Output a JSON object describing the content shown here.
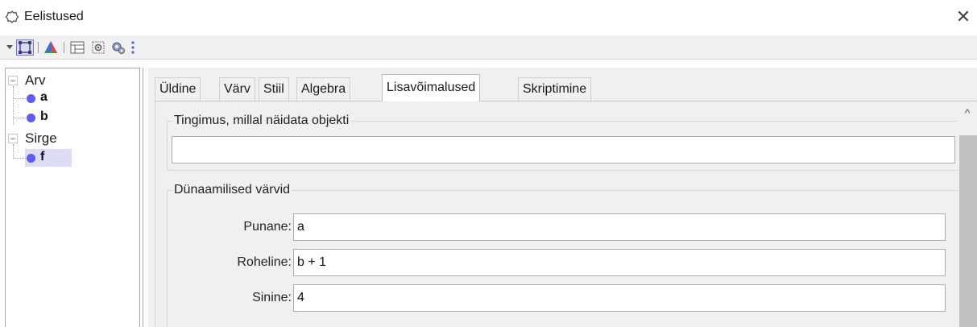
{
  "window": {
    "title": "Eelistused",
    "close_icon": "close-icon",
    "title_icon": "preferences-gear-icon"
  },
  "toolbar": {
    "icons": [
      "menu-triangle-icon",
      "graphics-view-icon",
      "graphics-3d-icon",
      "spreadsheet-layout-icon",
      "defaults-icon",
      "advanced-settings-icon",
      "more-icon"
    ]
  },
  "tree": {
    "groups": [
      {
        "label": "Arv",
        "items": [
          "a",
          "b"
        ]
      },
      {
        "label": "Sirge",
        "items": [
          "f"
        ]
      }
    ],
    "selected_item": "f",
    "point_color": "#5c5cf2"
  },
  "tabs": {
    "items": [
      "Üldine",
      "Värv",
      "Stiil",
      "Algebra",
      "Lisavõimalused",
      "Skriptimine"
    ],
    "active": "Lisavõimalused"
  },
  "condition": {
    "legend": "Tingimus, millal näidata objekti",
    "value": ""
  },
  "dynamic_colors": {
    "legend": "Dünaamilised värvid",
    "red_label": "Punane:",
    "red_value": "a",
    "green_label": "Roheline:",
    "green_value": "b + 1",
    "blue_label": "Sinine:",
    "blue_value": "4"
  }
}
